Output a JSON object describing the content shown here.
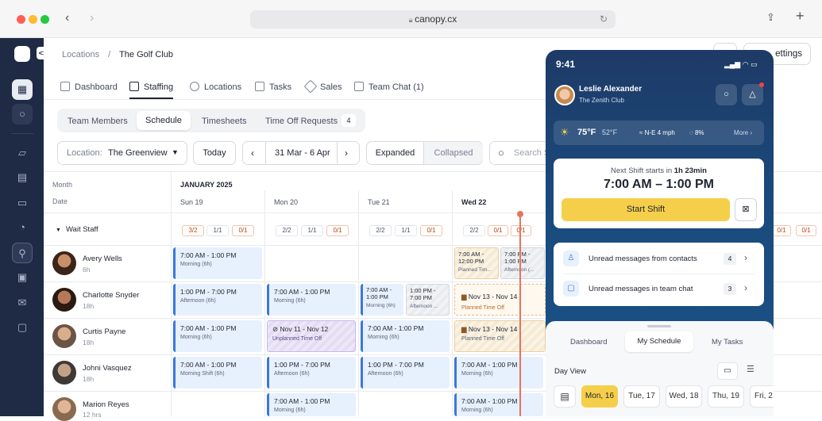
{
  "browser": {
    "url": "canopy.cx"
  },
  "breadcrumb": {
    "root": "Locations",
    "separator": "/",
    "current": "The Golf Club"
  },
  "settings_label": "ettings",
  "tabs": [
    {
      "label": "Dashboard"
    },
    {
      "label": "Staffing"
    },
    {
      "label": "Locations"
    },
    {
      "label": "Tasks"
    },
    {
      "label": "Sales"
    },
    {
      "label": "Team Chat (1)"
    }
  ],
  "subtabs": {
    "team_members": "Team Members",
    "schedule": "Schedule",
    "timesheets": "Timesheets",
    "time_off": "Time Off Requests",
    "time_off_count": "4"
  },
  "toolbar": {
    "location_prefix": "Location:",
    "location_value": "The Greenview",
    "today": "Today",
    "range": "31 Mar - 6 Apr",
    "expanded": "Expanded",
    "collapsed": "Collapsed",
    "search_placeholder": "Search S"
  },
  "grid": {
    "month_label": "Month",
    "date_label": "Date",
    "month_value": "JANUARY 2025",
    "days": [
      "Sun 19",
      "Mon 20",
      "Tue 21",
      "Wed 22"
    ],
    "group": "Wait Staff",
    "badges": {
      "sun": [
        "3/2",
        "1/1",
        "0/1"
      ],
      "mon": [
        "2/2",
        "1/1",
        "0/1"
      ],
      "tue": [
        "2/2",
        "1/1",
        "0/1"
      ],
      "wed": [
        "2/2",
        "0/1",
        "0/1"
      ],
      "far": [
        "0/1",
        "0/1"
      ]
    }
  },
  "employees": [
    {
      "name": "Avery Wells",
      "hours": "6h"
    },
    {
      "name": "Charlotte Snyder",
      "hours": "18h"
    },
    {
      "name": "Curtis Payne",
      "hours": "18h"
    },
    {
      "name": "Johni Vasquez",
      "hours": "18h"
    },
    {
      "name": "Marion Reyes",
      "hours": "12 hrs"
    }
  ],
  "shifts": {
    "r1_sun": {
      "time": "7:00 AM - 1:00 PM",
      "sub": "Morning (6h)"
    },
    "r1_wed_a": {
      "time": "7:00 AM - 12:00 PM",
      "sub": "Planned Tim..."
    },
    "r1_wed_b": {
      "time": "7:00 PM - 1:00 PM",
      "sub": "Afternoon (..."
    },
    "r2_sun": {
      "time": "1:00 PM - 7:00 PM",
      "sub": "Afternoon (6h)"
    },
    "r2_mon": {
      "time": "7:00 AM - 1:00 PM",
      "sub": "Morning (6h)"
    },
    "r2_tue_a": {
      "time": "7:00 AM - 1:00 PM",
      "sub": "Morning (6h)"
    },
    "r2_tue_b": {
      "time": "1:00 PM - 7:00 PM",
      "sub": "Afternoon ..."
    },
    "r2_wed": {
      "time": "Nov 13 - Nov 14",
      "sub": "Planned Time Off"
    },
    "r3_sun": {
      "time": "7:00 AM - 1:00 PM",
      "sub": "Morning (6h)"
    },
    "r3_mon": {
      "time": "Nov 11 - Nov 12",
      "sub": "Unplanned Time Off"
    },
    "r3_tue": {
      "time": "7:00 AM - 1:00 PM",
      "sub": "Morning (6h)"
    },
    "r3_wed": {
      "time": "Nov 13 - Nov 14",
      "sub": "Planned Time Off"
    },
    "r4_sun": {
      "time": "7:00 AM - 1:00 PM",
      "sub": "Morning Shift (6h)"
    },
    "r4_mon": {
      "time": "1:00 PM - 7:00 PM",
      "sub": "Afternoon (6h)"
    },
    "r4_tue": {
      "time": "1:00 PM - 7:00 PM",
      "sub": "Afternoon (6h)"
    },
    "r4_wed": {
      "time": "7:00 AM - 1:00 PM",
      "sub": "Morning (6h)"
    },
    "r5_mon": {
      "time": "7:00 AM - 1:00 PM",
      "sub": "Morning (6h)"
    },
    "r5_wed": {
      "time": "7:00 AM - 1:00 PM",
      "sub": "Morning (6h)"
    }
  },
  "phone": {
    "time": "9:41",
    "user_name": "Leslie Alexander",
    "user_org": "The Zenith Club",
    "weather": {
      "temp": "75°F",
      "low": "52°F",
      "wind": "N-E 4 mph",
      "rain": "8%",
      "more": "More"
    },
    "next_shift_prefix": "Next Shift starts in",
    "next_shift_time": "1h 23min",
    "shift_range": "7:00 AM – 1:00 PM",
    "start_shift": "Start Shift",
    "messages": [
      {
        "label": "Unread messages from contacts",
        "count": "4"
      },
      {
        "label": "Unread messages in team chat",
        "count": "3"
      }
    ],
    "bottom_tabs": [
      "Dashboard",
      "My Schedule",
      "My Tasks"
    ],
    "day_view": "Day View",
    "days": [
      "Mon, 16",
      "Tue, 17",
      "Wed, 18",
      "Thu, 19",
      "Fri, 2"
    ]
  },
  "colors": {
    "accent": "#f5cf4a",
    "sidebar": "#1f2a44",
    "shift_blue": "#3a78d8",
    "now_line": "#e8735e"
  }
}
